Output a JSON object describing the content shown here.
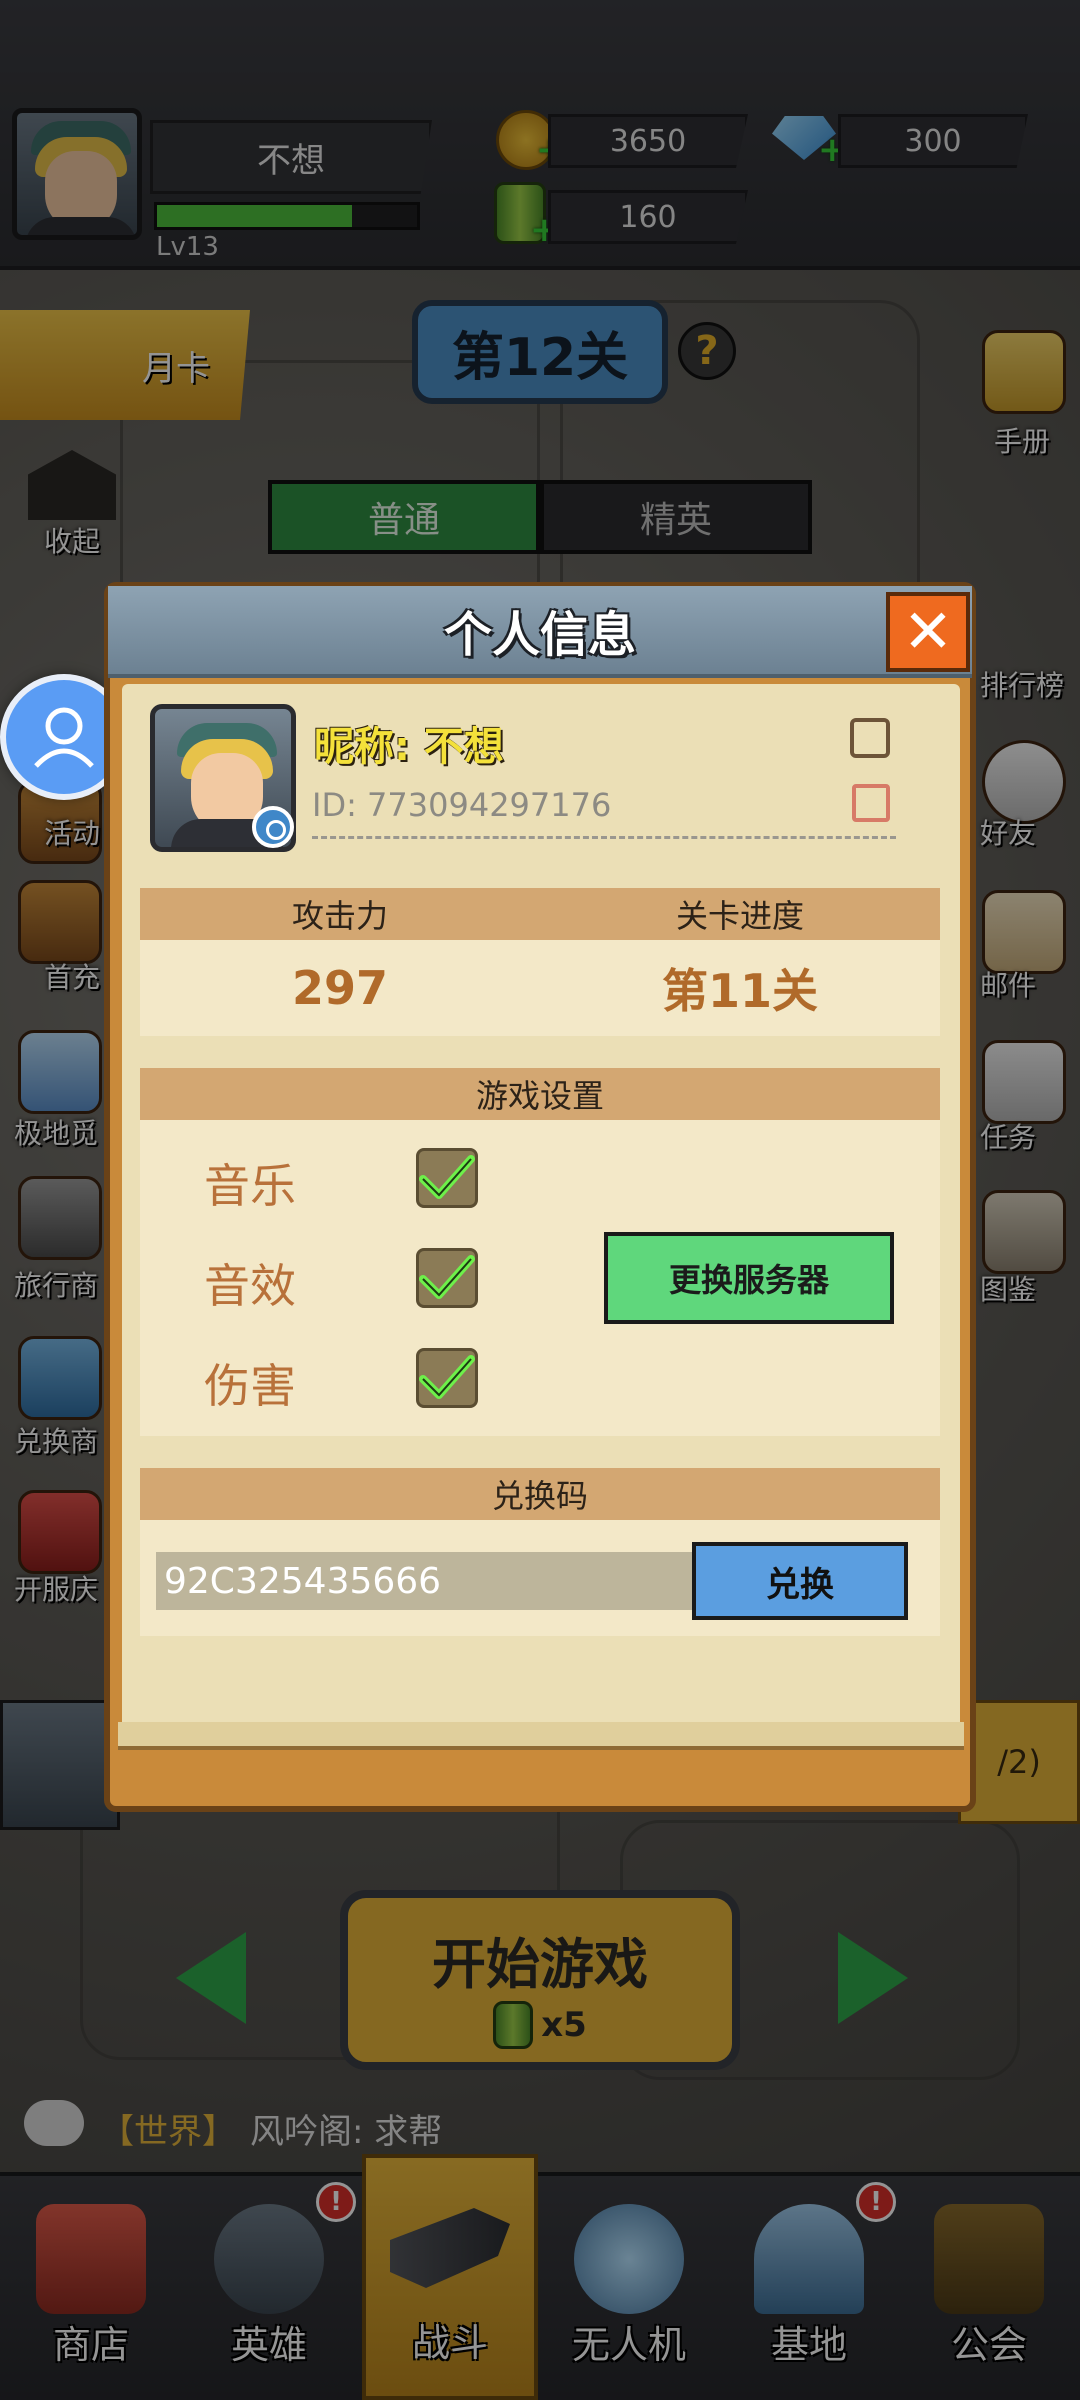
{
  "player": {
    "name": "不想",
    "level": "Lv13",
    "exp_fraction": 0.75
  },
  "resources": {
    "gold": "3650",
    "gems": "300",
    "energy": "160"
  },
  "stage": {
    "title": "第12关",
    "help": "?",
    "tabs": [
      "普通",
      "精英"
    ]
  },
  "left_menu": {
    "month_card": "月卡",
    "collapse": "收起",
    "event": "活动",
    "first_charge": "首充",
    "polar": "极地觅",
    "merchant": "旅行商",
    "exchange_shop": "兑换商",
    "server_celebration": "开服庆"
  },
  "right_menu": {
    "handbook": "手册",
    "ranking": "排行榜",
    "friends": "好友",
    "mail": "邮件",
    "tasks": "任务",
    "codex": "图鉴"
  },
  "dialog": {
    "title": "个人信息",
    "close": "✕",
    "nickname": "昵称: 不想",
    "id": "ID: 773094297176",
    "attack_label": "攻击力",
    "attack_value": "297",
    "progress_label": "关卡进度",
    "progress_value": "第11关",
    "settings_title": "游戏设置",
    "settings": [
      {
        "label": "音乐",
        "checked": true
      },
      {
        "label": "音效",
        "checked": true
      },
      {
        "label": "伤害",
        "checked": true
      }
    ],
    "change_server": "更换服务器",
    "redeem_title": "兑换码",
    "redeem_value": "92C325435666",
    "redeem_button": "兑换"
  },
  "bg_partial": "/2)",
  "play": {
    "start": "开始游戏",
    "cost": "x5"
  },
  "chat": {
    "channel": "【世界】",
    "message": "风吟阁: 求帮"
  },
  "nav": [
    "商店",
    "英雄",
    "战斗",
    "无人机",
    "基地",
    "公会"
  ],
  "nav_badges": {
    "hero": "!",
    "base": "!"
  },
  "colors": {
    "accent_green": "#5fd77c",
    "accent_blue": "#5b9ee0",
    "close_orange": "#ef6a1f",
    "title_gold": "#f4e13a",
    "stat_brown": "#b06a2a"
  }
}
